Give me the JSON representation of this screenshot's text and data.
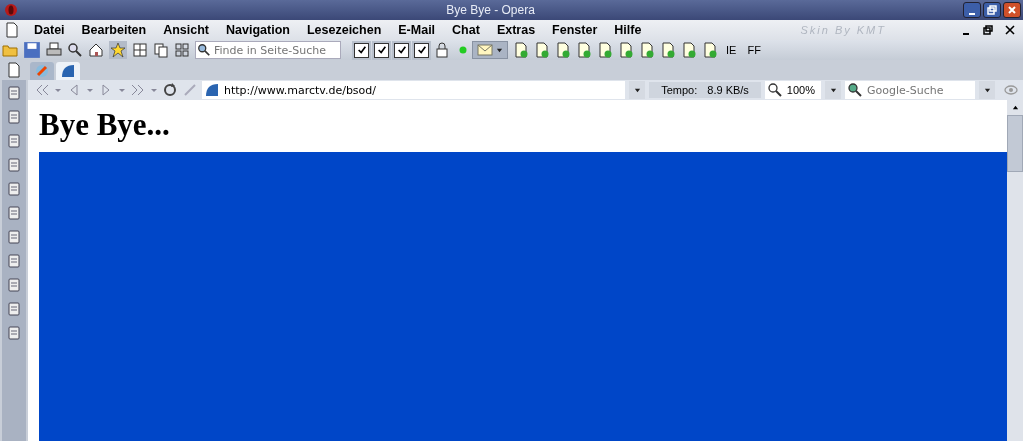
{
  "window": {
    "title": "Bye Bye - Opera"
  },
  "menu": [
    "Datei",
    "Bearbeiten",
    "Ansicht",
    "Navigation",
    "Lesezeichen",
    "E-Mail",
    "Chat",
    "Extras",
    "Fenster",
    "Hilfe"
  ],
  "skin_label": "Skin By KMT",
  "toolbar": {
    "find_placeholder": "Finde in Seite-Suche",
    "checkboxes": [
      {
        "checked": true
      },
      {
        "checked": true
      },
      {
        "checked": true
      },
      {
        "checked": true
      }
    ],
    "buttons": [
      "IE",
      "FF"
    ]
  },
  "address_bar": {
    "url": "http://www.marctv.de/bsod/",
    "speed_label": "Tempo:",
    "speed": "8.9 KB/s",
    "zoom": "100%",
    "search_placeholder": "Google-Suche"
  },
  "page": {
    "heading": "Bye Bye..."
  }
}
